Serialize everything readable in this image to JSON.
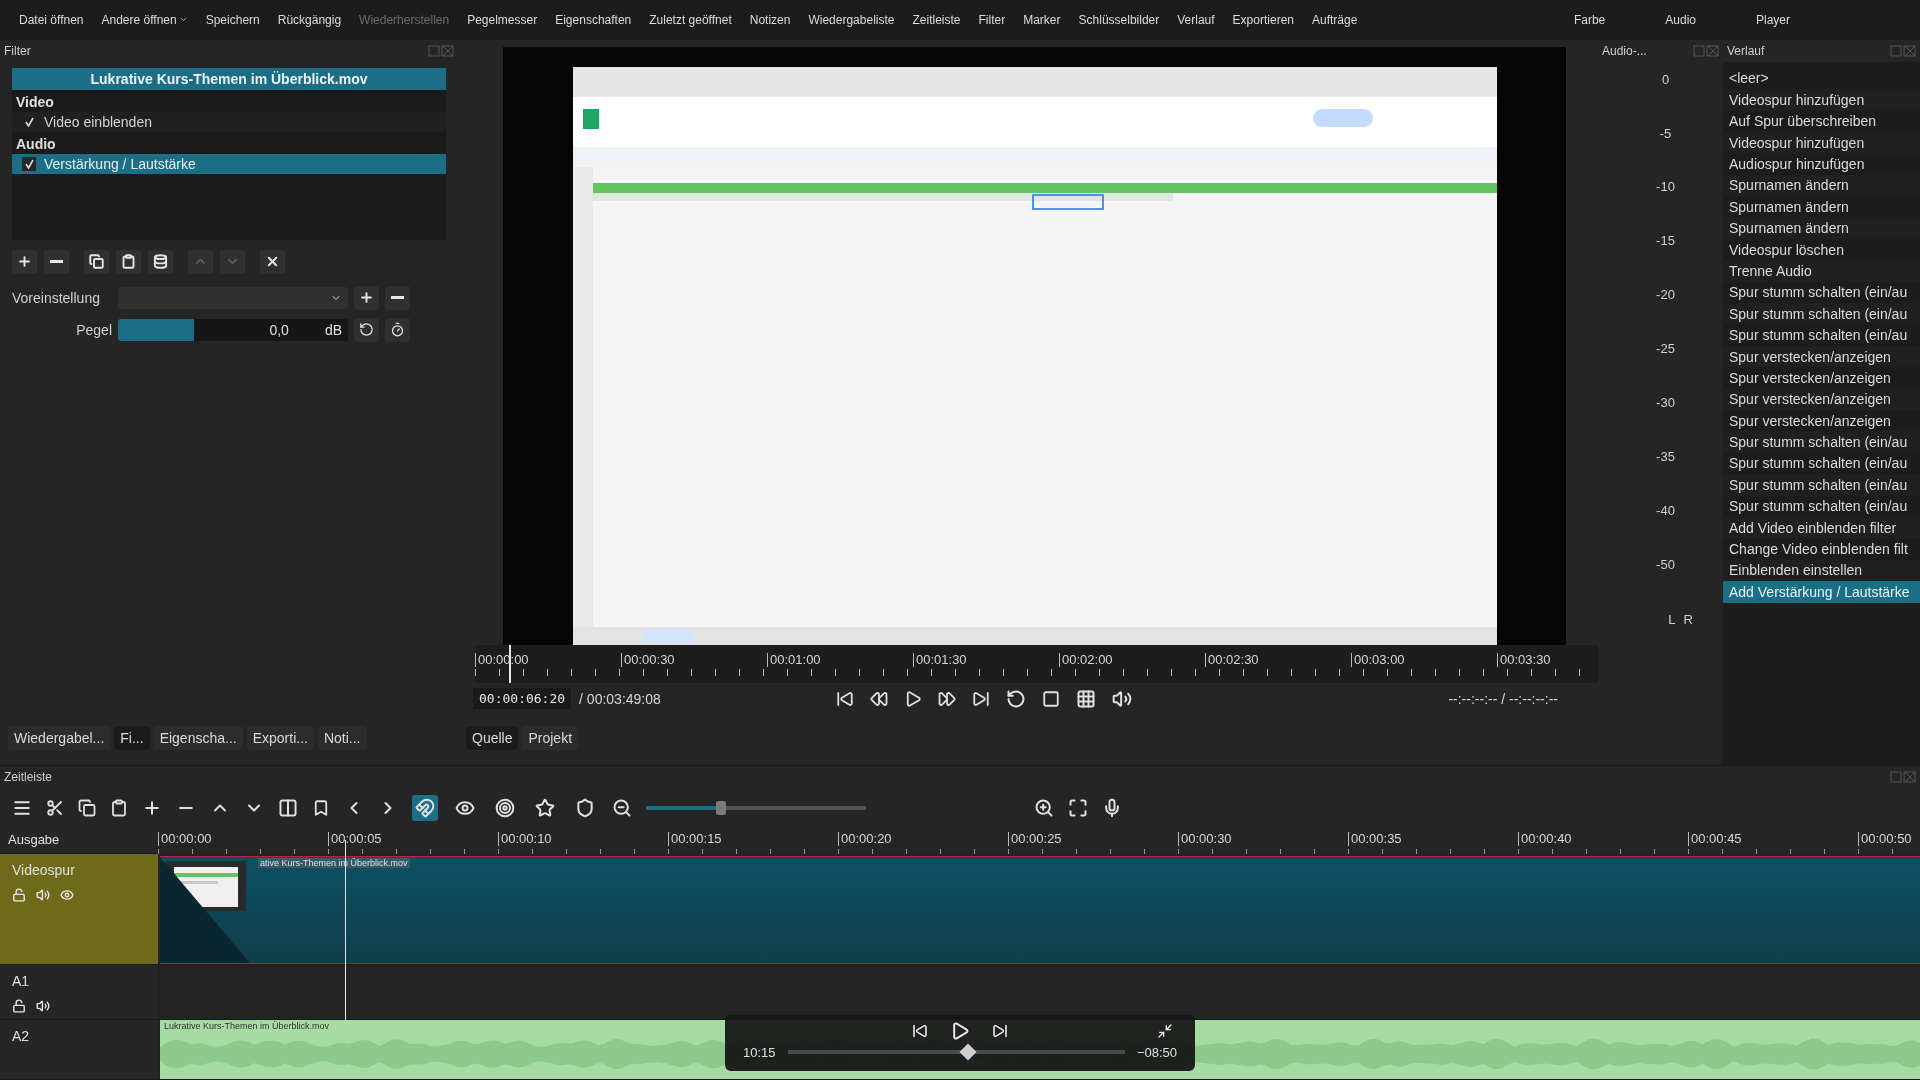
{
  "menu_bar": {
    "items": [
      {
        "label": "Datei öffnen",
        "disabled": false
      },
      {
        "label": "Andere öffnen",
        "disabled": false,
        "dropdown": true
      },
      {
        "label": "Speichern",
        "disabled": false
      },
      {
        "label": "Rückgängig",
        "disabled": false
      },
      {
        "label": "Wiederherstellen",
        "disabled": true
      },
      {
        "label": "Pegelmesser",
        "disabled": false
      },
      {
        "label": "Eigenschaften",
        "disabled": false
      },
      {
        "label": "Zuletzt geöffnet",
        "disabled": false
      },
      {
        "label": "Notizen",
        "disabled": false
      },
      {
        "label": "Wiedergabeliste",
        "disabled": false
      },
      {
        "label": "Zeitleiste",
        "disabled": false
      },
      {
        "label": "Filter",
        "disabled": false
      },
      {
        "label": "Marker",
        "disabled": false
      },
      {
        "label": "Schlüsselbilder",
        "disabled": false
      },
      {
        "label": "Verlauf",
        "disabled": false
      },
      {
        "label": "Exportieren",
        "disabled": false
      },
      {
        "label": "Aufträge",
        "disabled": false
      }
    ],
    "layouts": [
      "Farbe",
      "Audio",
      "Player"
    ]
  },
  "filter_panel": {
    "title": "Filter",
    "clip_name": "Lukrative Kurs-Themen im Überblick.mov",
    "groups": [
      {
        "label": "Video",
        "filters": [
          {
            "label": "Video einblenden",
            "checked": true,
            "selected": false
          }
        ]
      },
      {
        "label": "Audio",
        "filters": [
          {
            "label": "Verstärkung / Lautstärke",
            "checked": true,
            "selected": true
          }
        ]
      }
    ],
    "toolbar": [
      {
        "disabled": false
      },
      {
        "disabled": false
      },
      {
        "disabled": false
      },
      {
        "disabled": false
      },
      {
        "disabled": false
      },
      {
        "disabled": true
      },
      {
        "disabled": true
      },
      {
        "disabled": false
      }
    ],
    "preset_label": "Voreinstellung",
    "gain": {
      "label": "Pegel",
      "level": 0.33,
      "value": "0,0",
      "unit": "dB"
    }
  },
  "left_tabs": [
    {
      "label": "Wiedergabel...",
      "selected": false
    },
    {
      "label": "Fi...",
      "selected": true
    },
    {
      "label": "Eigenscha...",
      "selected": false
    },
    {
      "label": "Exporti...",
      "selected": false
    },
    {
      "label": "Noti...",
      "selected": false
    }
  ],
  "preview": {
    "kind": "picture",
    "ruler": [
      "00:00:00",
      "00:00:30",
      "00:01:00",
      "00:01:30",
      "00:02:00",
      "00:02:30",
      "00:03:00",
      "00:03:30"
    ],
    "playhead": {
      "level": 0.03
    },
    "timecode": "00:00:06:20",
    "duration": "/ 00:03:49:08",
    "in_out": "--:--:--:-- / --:--:--:--",
    "tabs": [
      {
        "label": "Quelle",
        "selected": true
      },
      {
        "label": "Projekt",
        "selected": false
      }
    ]
  },
  "audio_meter": {
    "title": "Audio-...",
    "scale": [
      "0",
      "-5",
      "-10",
      "-15",
      "-20",
      "-25",
      "-30",
      "-35",
      "-40",
      "-50"
    ],
    "channels": [
      "L",
      "R"
    ]
  },
  "history": {
    "title": "Verlauf",
    "items": [
      {
        "label": "<leer>",
        "selected": false
      },
      {
        "label": "Videospur hinzufügen",
        "selected": false
      },
      {
        "label": "Auf Spur überschreiben",
        "selected": false
      },
      {
        "label": "Videospur hinzufügen",
        "selected": false
      },
      {
        "label": "Audiospur hinzufügen",
        "selected": false
      },
      {
        "label": "Spurnamen ändern",
        "selected": false
      },
      {
        "label": "Spurnamen ändern",
        "selected": false
      },
      {
        "label": "Spurnamen ändern",
        "selected": false
      },
      {
        "label": "Videospur löschen",
        "selected": false
      },
      {
        "label": "Trenne Audio",
        "selected": false
      },
      {
        "label": "Spur stumm schalten (ein/au",
        "selected": false
      },
      {
        "label": "Spur stumm schalten (ein/au",
        "selected": false
      },
      {
        "label": "Spur stumm schalten (ein/au",
        "selected": false
      },
      {
        "label": "Spur verstecken/anzeigen",
        "selected": false
      },
      {
        "label": "Spur verstecken/anzeigen",
        "selected": false
      },
      {
        "label": "Spur verstecken/anzeigen",
        "selected": false
      },
      {
        "label": "Spur verstecken/anzeigen",
        "selected": false
      },
      {
        "label": "Spur stumm schalten (ein/au",
        "selected": false
      },
      {
        "label": "Spur stumm schalten (ein/au",
        "selected": false
      },
      {
        "label": "Spur stumm schalten (ein/au",
        "selected": false
      },
      {
        "label": "Spur stumm schalten (ein/au",
        "selected": false
      },
      {
        "label": "Add Video einblenden filter",
        "selected": false
      },
      {
        "label": "Change Video einblenden filt",
        "selected": false
      },
      {
        "label": "Einblenden einstellen",
        "selected": false
      },
      {
        "label": "Add Verstärkung / Lautstärke",
        "selected": true
      }
    ]
  },
  "timeline": {
    "title": "Zeitleiste",
    "toggles": [
      {
        "selected": true
      },
      {
        "selected": false
      },
      {
        "selected": false
      },
      {
        "selected": false
      },
      {
        "selected": false
      }
    ],
    "zoom": {
      "level": 0.34
    },
    "output_label": "Ausgabe",
    "ruler": [
      "00:00:00",
      "00:00:05",
      "00:00:10",
      "00:00:15",
      "00:00:20",
      "00:00:25",
      "00:00:30",
      "00:00:35",
      "00:00:40",
      "00:00:45",
      "00:00:50"
    ],
    "playhead": {
      "level": 0.106
    },
    "tracks": [
      {
        "name": "Videospur",
        "kind": "video",
        "selected": true,
        "clip": "ative Kurs-Themen im Überblick.mov"
      },
      {
        "name": "A1",
        "kind": "audio",
        "selected": false
      },
      {
        "name": "A2",
        "kind": "audio",
        "selected": false,
        "clip": "Lukrative Kurs-Themen im Überblick.mov"
      }
    ]
  },
  "overlay_player": {
    "elapsed": "10:15",
    "remaining": "−08:50",
    "level": 0.535
  }
}
